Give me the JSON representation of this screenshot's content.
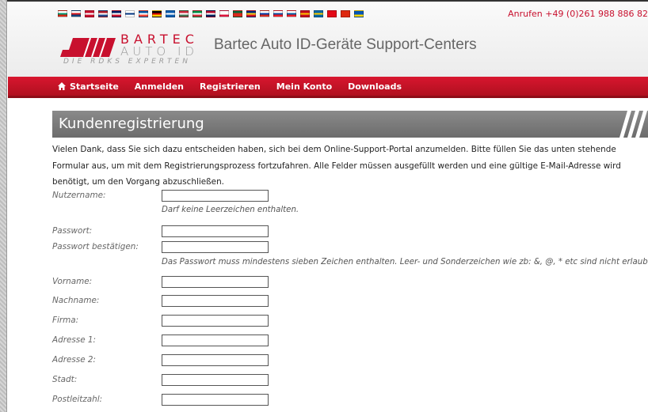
{
  "header": {
    "phone": "Anrufen +49 (0)261 988 886 82",
    "brand_line1": "BARTEC",
    "brand_line2": "AUTO ID",
    "tagline": "DIE RDKS EXPERTEN",
    "site_title": "Bartec Auto ID-Geräte Support-Centers",
    "flags": [
      {
        "name": "flag-bulgaria-icon",
        "colors": [
          "#ffffff",
          "#00966e",
          "#d62612"
        ]
      },
      {
        "name": "flag-czech-icon",
        "colors": [
          "#ffffff",
          "#d7141a",
          "#11457e"
        ]
      },
      {
        "name": "flag-denmark-icon",
        "colors": [
          "#c8102e",
          "#ffffff",
          "#c8102e"
        ]
      },
      {
        "name": "flag-netherlands-icon",
        "colors": [
          "#ae1c28",
          "#ffffff",
          "#21468b"
        ]
      },
      {
        "name": "flag-uk-icon",
        "colors": [
          "#012169",
          "#ffffff",
          "#c8102e"
        ]
      },
      {
        "name": "flag-finland-icon",
        "colors": [
          "#ffffff",
          "#003580",
          "#ffffff"
        ]
      },
      {
        "name": "flag-france-icon",
        "colors": [
          "#0055a4",
          "#ffffff",
          "#ef4135"
        ]
      },
      {
        "name": "flag-germany-icon",
        "colors": [
          "#000000",
          "#dd0000",
          "#ffce00"
        ]
      },
      {
        "name": "flag-greece-icon",
        "colors": [
          "#0d5eaf",
          "#ffffff",
          "#0d5eaf"
        ]
      },
      {
        "name": "flag-hungary-icon",
        "colors": [
          "#cd2a3e",
          "#ffffff",
          "#436f4d"
        ]
      },
      {
        "name": "flag-italy-icon",
        "colors": [
          "#009246",
          "#ffffff",
          "#ce2b37"
        ]
      },
      {
        "name": "flag-norway-icon",
        "colors": [
          "#ba0c2f",
          "#ffffff",
          "#00205b"
        ]
      },
      {
        "name": "flag-poland-icon",
        "colors": [
          "#ffffff",
          "#ffffff",
          "#dc143c"
        ]
      },
      {
        "name": "flag-portugal-icon",
        "colors": [
          "#046a38",
          "#da291c",
          "#da291c"
        ]
      },
      {
        "name": "flag-romania-icon",
        "colors": [
          "#002b7f",
          "#fcd116",
          "#ce1126"
        ]
      },
      {
        "name": "flag-russia-icon",
        "colors": [
          "#ffffff",
          "#0039a6",
          "#d52b1e"
        ]
      },
      {
        "name": "flag-slovakia-icon",
        "colors": [
          "#ffffff",
          "#0b4ea2",
          "#ee1c25"
        ]
      },
      {
        "name": "flag-slovenia-icon",
        "colors": [
          "#ffffff",
          "#005da4",
          "#ed1c24"
        ]
      },
      {
        "name": "flag-spain-icon",
        "colors": [
          "#c60b1e",
          "#ffc400",
          "#c60b1e"
        ]
      },
      {
        "name": "flag-sweden-icon",
        "colors": [
          "#006aa7",
          "#fecc00",
          "#006aa7"
        ]
      },
      {
        "name": "flag-turkey-icon",
        "colors": [
          "#e30a17",
          "#e30a17",
          "#e30a17"
        ]
      },
      {
        "name": "flag-china-icon",
        "colors": [
          "#de2910",
          "#de2910",
          "#de2910"
        ]
      },
      {
        "name": "flag-ukraine-icon",
        "colors": [
          "#0057b7",
          "#0057b7",
          "#ffd700"
        ]
      }
    ]
  },
  "nav": {
    "items": [
      {
        "label": "Startseite",
        "name": "nav-startseite"
      },
      {
        "label": "Anmelden",
        "name": "nav-anmelden"
      },
      {
        "label": "Registrieren",
        "name": "nav-registrieren"
      },
      {
        "label": "Mein Konto",
        "name": "nav-mein-konto"
      },
      {
        "label": "Downloads",
        "name": "nav-downloads"
      }
    ]
  },
  "page": {
    "title": "Kundenregistrierung",
    "intro": "Vielen Dank, dass Sie sich dazu entscheiden haben, sich bei dem Online-Support-Portal anzumelden. Bitte füllen Sie das unten stehende Formular aus, um mit dem Registrierungsprozess fortzufahren. Alle Felder müssen ausgefüllt werden und eine gültige E-Mail-Adresse wird benötigt, um den Vorgang abzuschließen."
  },
  "form": {
    "fields": [
      {
        "label": "Nutzername:",
        "name": "username",
        "value": "",
        "hint": "Darf keine Leerzeichen enthalten."
      },
      {
        "label": "Passwort:",
        "name": "password",
        "value": "",
        "hint": ""
      },
      {
        "label": "Passwort bestätigen:",
        "name": "password-confirm",
        "value": "",
        "hint": "Das Passwort muss mindestens sieben Zeichen enthalten. Leer- und Sonderzeichen wie zb: &, @, * etc sind nicht erlaubt."
      },
      {
        "label": "Vorname:",
        "name": "first-name",
        "value": "",
        "hint": ""
      },
      {
        "label": "Nachname:",
        "name": "last-name",
        "value": "",
        "hint": ""
      },
      {
        "label": "Firma:",
        "name": "company",
        "value": "",
        "hint": ""
      },
      {
        "label": "Adresse 1:",
        "name": "address-1",
        "value": "",
        "hint": ""
      },
      {
        "label": "Adresse 2:",
        "name": "address-2",
        "value": "",
        "hint": ""
      },
      {
        "label": "Stadt:",
        "name": "city",
        "value": "",
        "hint": ""
      },
      {
        "label": "Postleitzahl:",
        "name": "postcode",
        "value": "",
        "hint": ""
      }
    ]
  }
}
